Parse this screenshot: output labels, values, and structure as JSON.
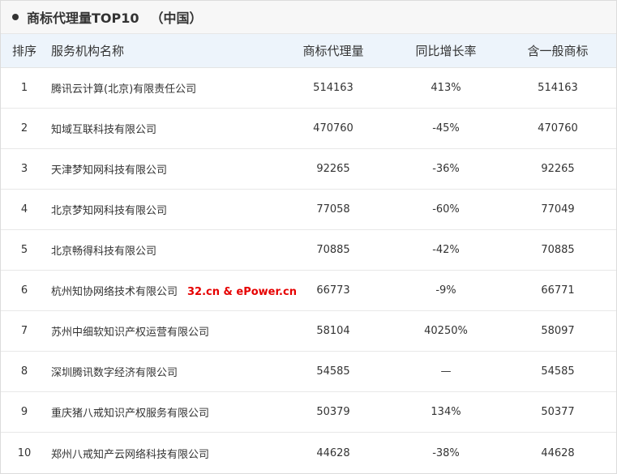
{
  "title": {
    "main": "商标代理量TOP10",
    "suffix": "（中国）"
  },
  "columns": {
    "rank": "排序",
    "name": "服务机构名称",
    "agency": "商标代理量",
    "growth": "同比增长率",
    "general": "含一般商标"
  },
  "watermark": "32.cn & ePower.cn",
  "rows": [
    {
      "rank": "1",
      "name": "腾讯云计算(北京)有限责任公司",
      "agency": "514163",
      "growth": "413%",
      "general": "514163"
    },
    {
      "rank": "2",
      "name": "知域互联科技有限公司",
      "agency": "470760",
      "growth": "-45%",
      "general": "470760"
    },
    {
      "rank": "3",
      "name": "天津梦知网科技有限公司",
      "agency": "92265",
      "growth": "-36%",
      "general": "92265"
    },
    {
      "rank": "4",
      "name": "北京梦知网科技有限公司",
      "agency": "77058",
      "growth": "-60%",
      "general": "77049"
    },
    {
      "rank": "5",
      "name": "北京畅得科技有限公司",
      "agency": "70885",
      "growth": "-42%",
      "general": "70885"
    },
    {
      "rank": "6",
      "name": "杭州知协网络技术有限公司",
      "agency": "66773",
      "growth": "-9%",
      "general": "66771"
    },
    {
      "rank": "7",
      "name": "苏州中细软知识产权运营有限公司",
      "agency": "58104",
      "growth": "40250%",
      "general": "58097"
    },
    {
      "rank": "8",
      "name": "深圳腾讯数字经济有限公司",
      "agency": "54585",
      "growth": "—",
      "general": "54585"
    },
    {
      "rank": "9",
      "name": "重庆猪八戒知识产权服务有限公司",
      "agency": "50379",
      "growth": "134%",
      "general": "50377"
    },
    {
      "rank": "10",
      "name": "郑州八戒知产云网络科技有限公司",
      "agency": "44628",
      "growth": "-38%",
      "general": "44628"
    }
  ]
}
